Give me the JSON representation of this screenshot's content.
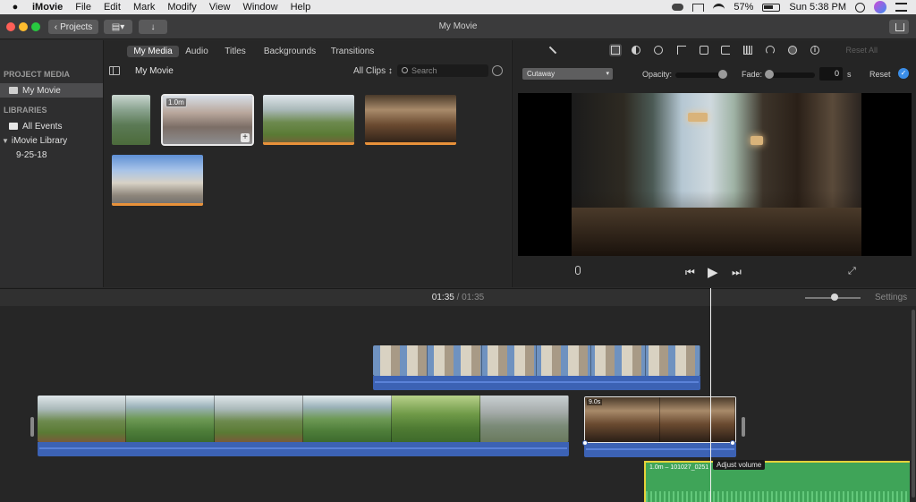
{
  "menubar": {
    "app": "iMovie",
    "items": [
      "File",
      "Edit",
      "Mark",
      "Modify",
      "View",
      "Window",
      "Help"
    ],
    "battery": "57%",
    "clock": "Sun 5:38 PM"
  },
  "titlebar": {
    "title": "My Movie",
    "projects_label": "Projects"
  },
  "library": {
    "project_media_heading": "PROJECT MEDIA",
    "project_item": "My Movie",
    "libraries_heading": "LIBRARIES",
    "all_events": "All Events",
    "library_name": "iMovie Library",
    "event": "9-25-18"
  },
  "browser": {
    "tabs": [
      "My Media",
      "Audio",
      "Titles",
      "Backgrounds",
      "Transitions"
    ],
    "active_tab": "My Media",
    "title": "My Movie",
    "filter": "All Clips ↕",
    "search_placeholder": "Search",
    "selected_clip_duration": "1.0m"
  },
  "viewer": {
    "reset_all": "Reset All",
    "overlay_mode": "Cutaway",
    "opacity_label": "Opacity:",
    "fade_label": "Fade:",
    "fade_value": "0",
    "fade_unit": "s",
    "reset_label": "Reset",
    "opacity_level": 1.0
  },
  "timeline": {
    "current_time": "01:35",
    "separator": "/",
    "total_time": "01:35",
    "settings_label": "Settings",
    "cafe_clip_duration": "9.0s",
    "music_clip_title": "1.0m – 101027_0251",
    "tooltip": "Adjust volume"
  },
  "colors": {
    "audio_blue": "#3c62b4",
    "music_green": "#3fa458",
    "selection_yellow": "#e4d23a",
    "accent_blue": "#3b8ee8"
  }
}
